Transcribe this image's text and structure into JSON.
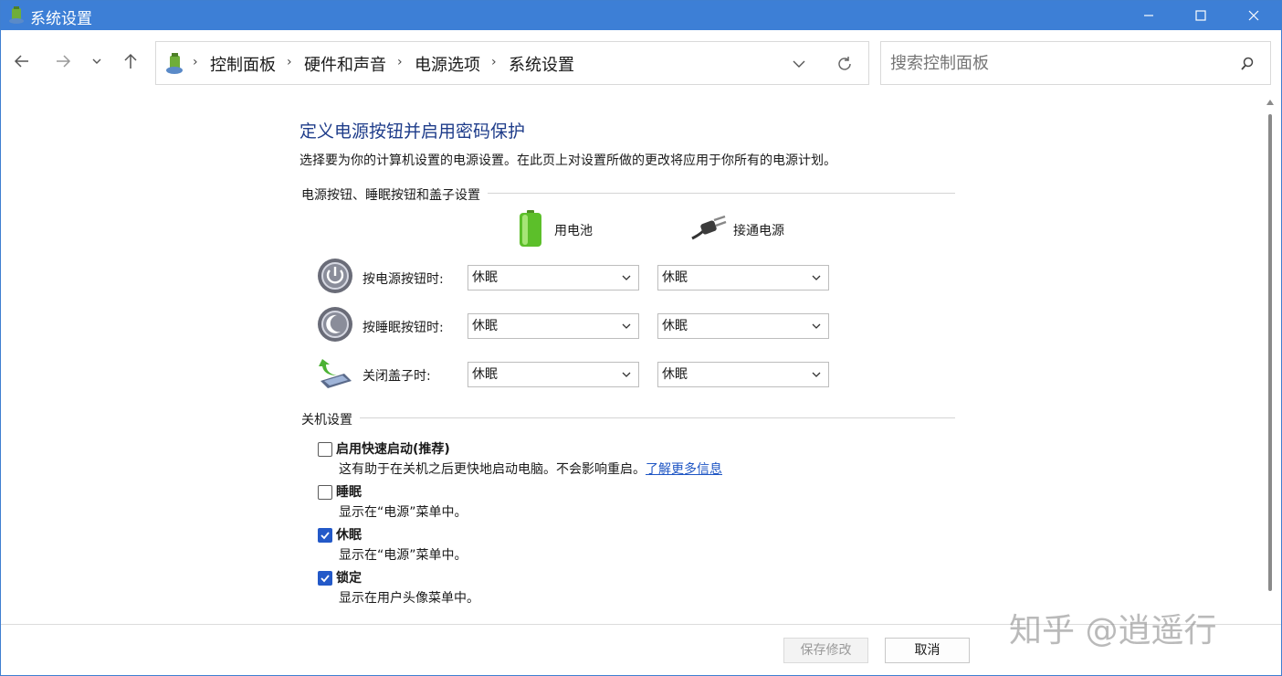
{
  "window": {
    "title": "系统设置",
    "accent_color": "#3d7fd6"
  },
  "breadcrumb": {
    "items": [
      "控制面板",
      "硬件和声音",
      "电源选项",
      "系统设置"
    ]
  },
  "search": {
    "placeholder": "搜索控制面板"
  },
  "page": {
    "title": "定义电源按钮并启用密码保护",
    "description": "选择要为你的计算机设置的电源设置。在此页上对设置所做的更改将应用于你所有的电源计划。"
  },
  "power_section": {
    "label": "电源按钮、睡眠按钮和盖子设置",
    "columns": {
      "battery": "用电池",
      "plugged": "接通电源"
    },
    "rows": [
      {
        "label": "按电源按钮时:",
        "battery": "休眠",
        "plugged": "休眠",
        "icon": "power-button-icon"
      },
      {
        "label": "按睡眠按钮时:",
        "battery": "休眠",
        "plugged": "休眠",
        "icon": "sleep-button-icon"
      },
      {
        "label": "关闭盖子时:",
        "battery": "休眠",
        "plugged": "休眠",
        "icon": "laptop-lid-icon"
      }
    ]
  },
  "shutdown_section": {
    "label": "关机设置",
    "options": [
      {
        "label": "启用快速启动(推荐)",
        "desc": "这有助于在关机之后更快地启动电脑。不会影响重启。",
        "link": "了解更多信息",
        "checked": false
      },
      {
        "label": "睡眠",
        "desc": "显示在“电源”菜单中。",
        "checked": false
      },
      {
        "label": "休眠",
        "desc": "显示在“电源”菜单中。",
        "checked": true
      },
      {
        "label": "锁定",
        "desc": "显示在用户头像菜单中。",
        "checked": true
      }
    ]
  },
  "footer": {
    "save_label": "保存修改",
    "cancel_label": "取消"
  },
  "watermark": "知乎 @逍遥行"
}
